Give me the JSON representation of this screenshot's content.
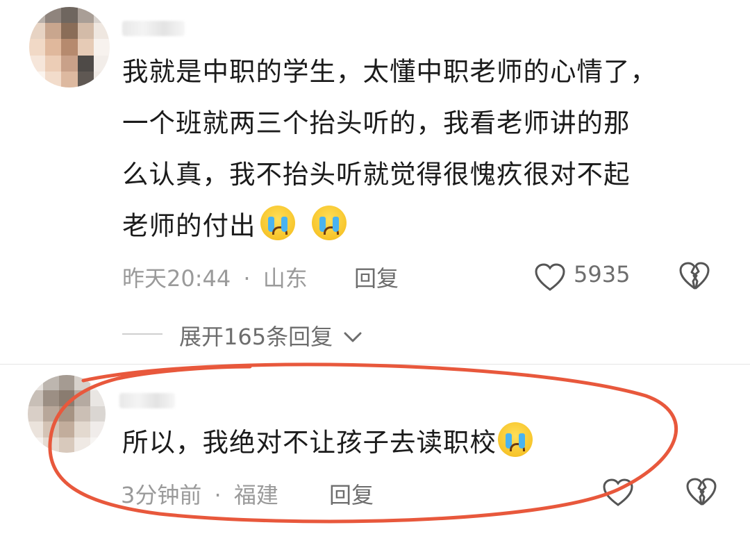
{
  "comments": [
    {
      "text_lines": [
        "我就是中职的学生，太懂中职老师的心情了，",
        "一个班就两三个抬头听的，我看老师讲的那",
        "么认真，我不抬头听就觉得很愧疚很对不起",
        "老师的付出"
      ],
      "emoji": [
        "crying-face",
        "crying-face"
      ],
      "time": "昨天20:44",
      "dot": "·",
      "location": "山东",
      "reply_label": "回复",
      "like_count": "5935",
      "expand_label": "展开165条回复"
    },
    {
      "text": "所以，我绝对不让孩子去读职校",
      "emoji": [
        "crying-face"
      ],
      "time": "3分钟前",
      "dot": "·",
      "location": "福建",
      "reply_label": "回复"
    }
  ],
  "colors": {
    "highlight": "#e8583c",
    "meta": "#9a9a9a",
    "text": "#1b1b1b"
  }
}
